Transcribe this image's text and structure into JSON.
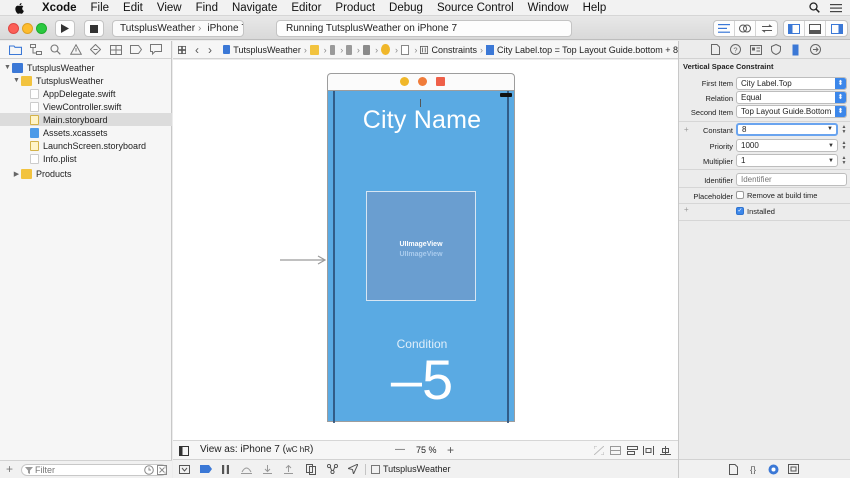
{
  "menubar": {
    "app_name": "Xcode",
    "items": [
      "File",
      "Edit",
      "View",
      "Find",
      "Navigate",
      "Editor",
      "Product",
      "Debug",
      "Source Control",
      "Window",
      "Help"
    ]
  },
  "toolbar": {
    "scheme_name": "TutsplusWeather",
    "device_name": "iPhone 7",
    "activity_text": "Running TutsplusWeather on iPhone 7"
  },
  "navigator": {
    "items": [
      {
        "label": "TutsplusWeather",
        "indent": 0,
        "kind": "project",
        "expanded": true
      },
      {
        "label": "TutsplusWeather",
        "indent": 1,
        "kind": "folder",
        "expanded": true
      },
      {
        "label": "AppDelegate.swift",
        "indent": 2,
        "kind": "swift"
      },
      {
        "label": "ViewController.swift",
        "indent": 2,
        "kind": "swift"
      },
      {
        "label": "Main.storyboard",
        "indent": 2,
        "kind": "storyboard",
        "selected": true
      },
      {
        "label": "Assets.xcassets",
        "indent": 2,
        "kind": "assets"
      },
      {
        "label": "LaunchScreen.storyboard",
        "indent": 2,
        "kind": "storyboard"
      },
      {
        "label": "Info.plist",
        "indent": 2,
        "kind": "plist"
      },
      {
        "label": "Products",
        "indent": 1,
        "kind": "folder",
        "expanded": false
      }
    ],
    "filter_placeholder": "Filter"
  },
  "jumpbar": {
    "project": "TutsplusWeather",
    "constraints": "Constraints",
    "current": "City Label.top = Top Layout Guide.bottom + 8"
  },
  "scene": {
    "city_name": "City Name",
    "image_view_title": "UIImageView",
    "image_view_subtitle": "UIImageView",
    "condition": "Condition",
    "temperature": "–5",
    "background_color": "#5aaae3"
  },
  "editor_bottom": {
    "view_as": "View as: iPhone 7 (",
    "view_as_traits": "wC hR",
    "view_as_close": ")",
    "zoom_minus": "—",
    "zoom": "75 %",
    "zoom_plus": "+"
  },
  "debug_bar": {
    "target": "TutsplusWeather"
  },
  "inspector": {
    "section_title": "Vertical Space Constraint",
    "first_item_label": "First Item",
    "first_item": "City Label.Top",
    "relation_label": "Relation",
    "relation": "Equal",
    "second_item_label": "Second Item",
    "second_item": "Top Layout Guide.Bottom",
    "constant_label": "Constant",
    "constant": "8",
    "priority_label": "Priority",
    "priority": "1000",
    "multiplier_label": "Multiplier",
    "multiplier": "1",
    "identifier_label": "Identifier",
    "identifier_placeholder": "Identifier",
    "placeholder_label": "Placeholder",
    "placeholder_option": "Remove at build time",
    "installed_label": "Installed",
    "accent_color": "#3c87ea"
  }
}
